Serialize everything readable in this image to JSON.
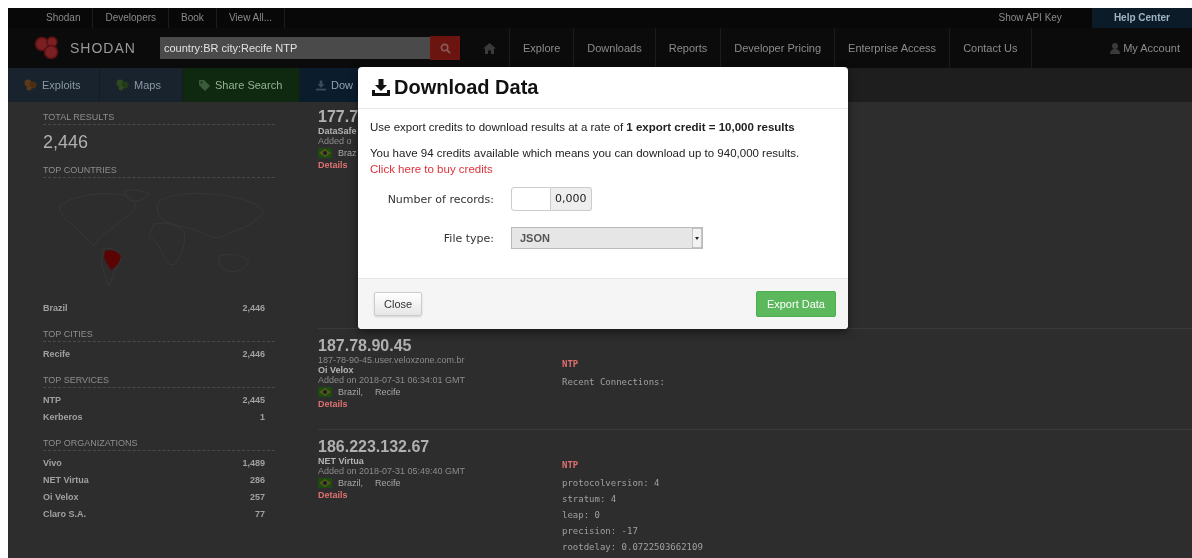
{
  "top_bar": {
    "links": [
      "Shodan",
      "Developers",
      "Book",
      "View All..."
    ],
    "api_key": "Show API Key",
    "help": "Help Center"
  },
  "nav": {
    "logo": "SHODAN",
    "search": {
      "value": "country:BR city:Recife NTP"
    },
    "items": [
      "Explore",
      "Downloads",
      "Reports",
      "Developer Pricing",
      "Enterprise Access",
      "Contact Us"
    ],
    "account": "My Account"
  },
  "subnav": [
    {
      "label": "Exploits",
      "kind": "exploits"
    },
    {
      "label": "Maps",
      "kind": "maps"
    },
    {
      "label": "Share Search",
      "kind": "share"
    },
    {
      "label": "Dow",
      "kind": "download"
    }
  ],
  "sidebar": {
    "total": {
      "heading": "TOTAL RESULTS",
      "value": "2,446"
    },
    "sections": [
      {
        "heading": "TOP COUNTRIES",
        "kind": "map",
        "rows": [
          {
            "label": "Brazil",
            "value": "2,446"
          }
        ]
      },
      {
        "heading": "TOP CITIES",
        "kind": "list",
        "rows": [
          {
            "label": "Recife",
            "value": "2,446"
          }
        ]
      },
      {
        "heading": "TOP SERVICES",
        "kind": "list",
        "rows": [
          {
            "label": "NTP",
            "value": "2,445"
          },
          {
            "label": "Kerberos",
            "value": "1"
          }
        ]
      },
      {
        "heading": "TOP ORGANIZATIONS",
        "kind": "list",
        "rows": [
          {
            "label": "Vivo",
            "value": "1,489"
          },
          {
            "label": "NET Virtua",
            "value": "286"
          },
          {
            "label": "Oi Velox",
            "value": "257"
          },
          {
            "label": "Claro S.A.",
            "value": "77"
          }
        ]
      }
    ]
  },
  "results": [
    {
      "ip": "177.7",
      "org": "DataSafe",
      "added": "Added o",
      "country": "Braz",
      "details": "Details"
    },
    {
      "ip": "187.78.90.45",
      "hostname": "187-78-90-45.user.veloxzone.com.br",
      "org": "Oi Velox",
      "added": "Added on 2018-07-31 06:34:01 GMT",
      "country": "Brazil,",
      "city": "Recife",
      "details": "Details",
      "banner": {
        "service": "NTP",
        "lines": [
          "Recent Connections:"
        ]
      }
    },
    {
      "ip": "186.223.132.67",
      "org": "NET Virtua",
      "added": "Added on 2018-07-31 05:49:40 GMT",
      "country": "Brazil,",
      "city": "Recife",
      "details": "Details",
      "banner": {
        "service": "NTP",
        "lines": [
          "protocolversion: 4",
          "stratum: 4",
          "leap: 0",
          "precision: -17",
          "rootdelay: 0.0722503662109"
        ]
      }
    }
  ],
  "modal": {
    "title": "Download Data",
    "intro": "Use export credits to download results at a rate of **1 export credit = 10,000 results**",
    "credits": "You have 94 credits available which means you can download up to 940,000 results.",
    "buy_link": "Click here to buy credits",
    "records": {
      "label": "Number of records:",
      "suffix": "0,000"
    },
    "file_type": {
      "label": "File type:",
      "value": "JSON"
    },
    "buttons": {
      "close": "Close",
      "export": "Export Data"
    }
  }
}
